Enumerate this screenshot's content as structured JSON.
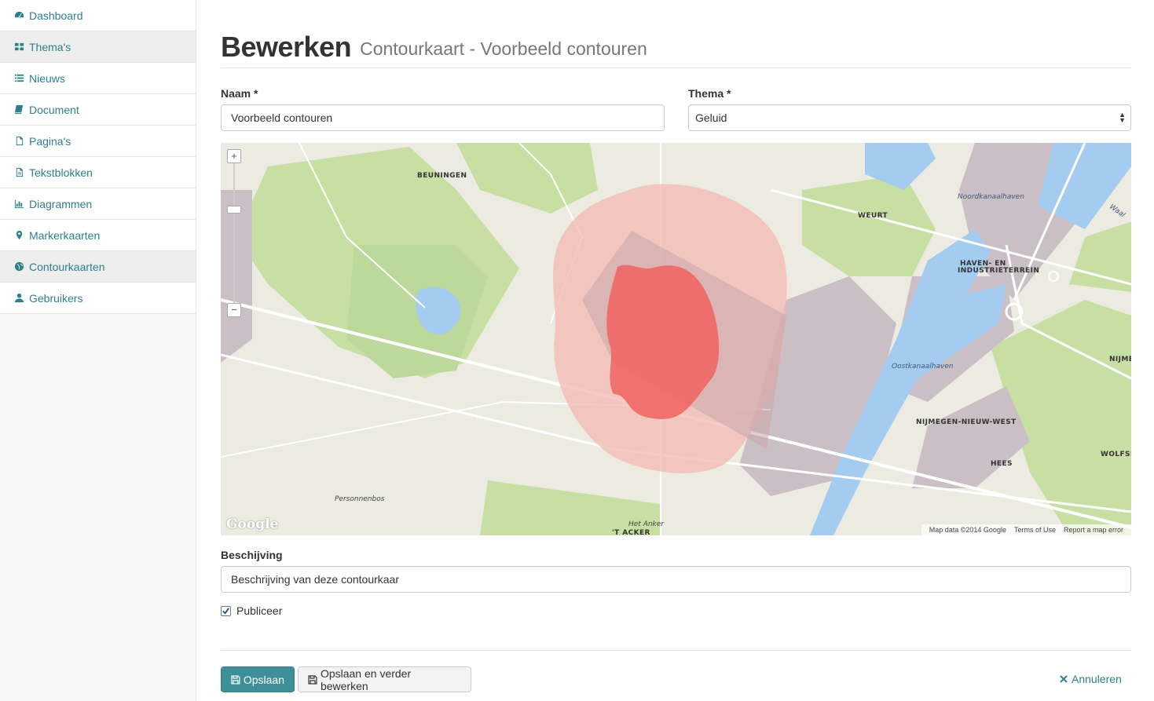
{
  "sidebar": {
    "items": [
      {
        "label": "Dashboard",
        "icon": "dashboard-icon"
      },
      {
        "label": "Thema's",
        "icon": "grid-icon"
      },
      {
        "label": "Nieuws",
        "icon": "list-icon"
      },
      {
        "label": "Document",
        "icon": "book-icon"
      },
      {
        "label": "Pagina's",
        "icon": "file-icon"
      },
      {
        "label": "Tekstblokken",
        "icon": "file-text-icon"
      },
      {
        "label": "Diagrammen",
        "icon": "bar-chart-icon"
      },
      {
        "label": "Markerkaarten",
        "icon": "map-marker-icon"
      },
      {
        "label": "Contourkaarten",
        "icon": "globe-icon"
      },
      {
        "label": "Gebruikers",
        "icon": "user-icon"
      }
    ]
  },
  "header": {
    "title": "Bewerken",
    "subtitle": "Contourkaart - Voorbeeld contouren"
  },
  "form": {
    "name_label": "Naam *",
    "name_value": "Voorbeeld contouren",
    "theme_label": "Thema *",
    "theme_value": "Geluid",
    "description_label": "Beschijving",
    "description_value": "Beschrijving van deze contourkaar",
    "publish_label": "Publiceer",
    "publish_checked": true
  },
  "map": {
    "labels": {
      "beuningen": "BEUNINGEN",
      "weurt": "WEURT",
      "noordkanaalhaven": "Noordkanaalhaven",
      "waal": "Waal",
      "haven1": "HAVEN- EN",
      "haven2": "INDUSTRIETERREIN",
      "oostkanaalhaven": "Oostkanaalhaven",
      "nijme": "NIJME",
      "nijmegen_west": "NIJMEGEN-NIEUW-WEST",
      "wolfsk": "WOLFSK",
      "hees": "HEES",
      "personnenbos": "Personnenbos",
      "het_anker": "Het Anker",
      "t_acker": "'T ACKER"
    },
    "google": "Google",
    "attribution": [
      "Map data ©2014 Google",
      "Terms of Use",
      "Report a map error"
    ],
    "zoom_in": "+",
    "zoom_out": "−",
    "colors": {
      "outer_contour": "#f4b6b0",
      "inner_contour": "#f0615f",
      "water": "#a3ccf0",
      "green": "#c8dfa4",
      "industrial": "#c9bfc4"
    }
  },
  "actions": {
    "save_label": "Opslaan",
    "save_continue_label": "Opslaan en verder bewerken",
    "cancel_label": "Annuleren"
  },
  "accent_color": "#3f8f98"
}
